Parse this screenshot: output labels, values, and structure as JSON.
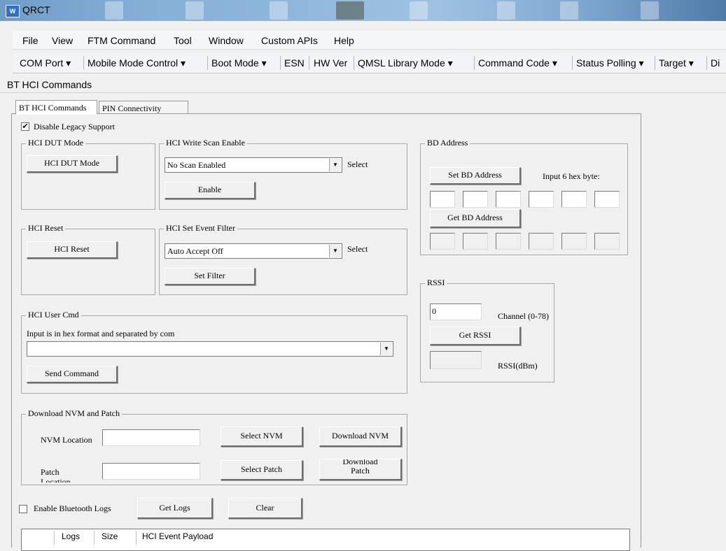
{
  "window": {
    "title": "QRCT"
  },
  "menu": {
    "items": [
      {
        "label": "File"
      },
      {
        "label": "View"
      },
      {
        "label": "FTM Command"
      },
      {
        "label": "Tool"
      },
      {
        "label": "Window"
      },
      {
        "label": "Custom APIs"
      },
      {
        "label": "Help"
      }
    ]
  },
  "toolbar": {
    "items": [
      "COM Port ▾",
      "Mobile Mode Control ▾",
      "Boot Mode ▾",
      "ESN",
      "HW Ver",
      "QMSL Library Mode ▾",
      "Command Code ▾",
      "Status Polling ▾",
      "Target ▾",
      "Di"
    ]
  },
  "document": {
    "title": "BT HCI Commands"
  },
  "tabs": [
    {
      "label": "BT HCI Commands"
    },
    {
      "label": "PIN Connectivity"
    }
  ],
  "legacy": {
    "label": "Disable Legacy Support",
    "checked": true
  },
  "dut": {
    "group": "HCI DUT Mode",
    "button": "HCI DUT Mode"
  },
  "scan": {
    "group": "HCI Write Scan Enable",
    "value": "No Scan Enabled",
    "select_label": "Select",
    "button": "Enable"
  },
  "reset": {
    "group": "HCI Reset",
    "button": "HCI Reset"
  },
  "filter": {
    "group": "HCI Set Event Filter",
    "value": "Auto Accept Off",
    "select_label": "Select",
    "button": "Set Filter"
  },
  "usercmd": {
    "group": "HCI User Cmd",
    "hint": "Input is in hex format and separated by com",
    "value": "",
    "button": "Send Command"
  },
  "bdaddr": {
    "group": "BD Address",
    "set_button": "Set BD Address",
    "input_label": "Input 6  hex byte:",
    "get_button": "Get BD Address"
  },
  "rssi": {
    "group": "RSSI",
    "channel_value": "0",
    "channel_label": "Channel (0-78)",
    "button": "Get RSSI",
    "rssi_value": "",
    "rssi_label": "RSSI(dBm)"
  },
  "nvm": {
    "group": "Download NVM and Patch",
    "nvm_label": "NVM Location",
    "nvm_value": "",
    "select_nvm": "Select NVM",
    "download_nvm": "Download NVM",
    "patch_label_1": "Patch",
    "patch_label_2": "Location",
    "patch_value": "",
    "select_patch": "Select Patch",
    "download_patch_1": "Download",
    "download_patch_2": "Patch"
  },
  "logs": {
    "enable_label": "Enable Bluetooth Logs",
    "enabled": false,
    "get_button": "Get Logs",
    "clear_button": "Clear"
  },
  "logs_table": {
    "columns": [
      "Logs",
      "Size",
      "HCI Event Payload"
    ]
  }
}
